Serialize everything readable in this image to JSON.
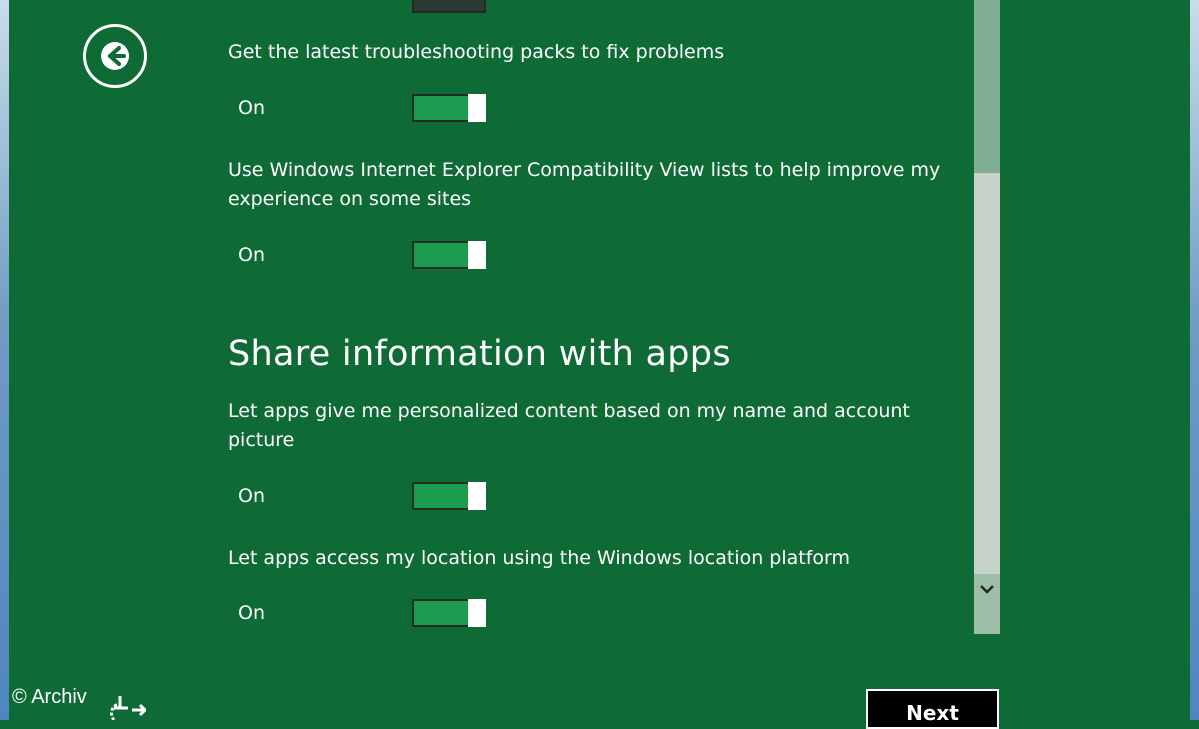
{
  "icons": {
    "back": "back-arrow-icon",
    "scroll_down": "chevron-down-icon",
    "ease_of_access": "ease-of-access-icon"
  },
  "colors": {
    "background": "#0f6b35",
    "toggle_on": "#1c9a50",
    "scrollbar_track": "#c7d2cb",
    "scrollbar_thumb": "#7fae92",
    "next_button": "#000000"
  },
  "settings": [
    {
      "label": "Get the latest troubleshooting packs to fix problems",
      "state": "On"
    },
    {
      "label": "Use Windows Internet Explorer Compatibility View lists to help improve my experience on some sites",
      "state": "On"
    }
  ],
  "section": {
    "heading": "Share information with apps",
    "settings": [
      {
        "label": "Let apps give me personalized content based on my name and account picture",
        "state": "On"
      },
      {
        "label": "Let apps access my location using the Windows location platform",
        "state": "On"
      }
    ]
  },
  "footer": {
    "watermark": "© Archiv",
    "next_label": "Next"
  }
}
